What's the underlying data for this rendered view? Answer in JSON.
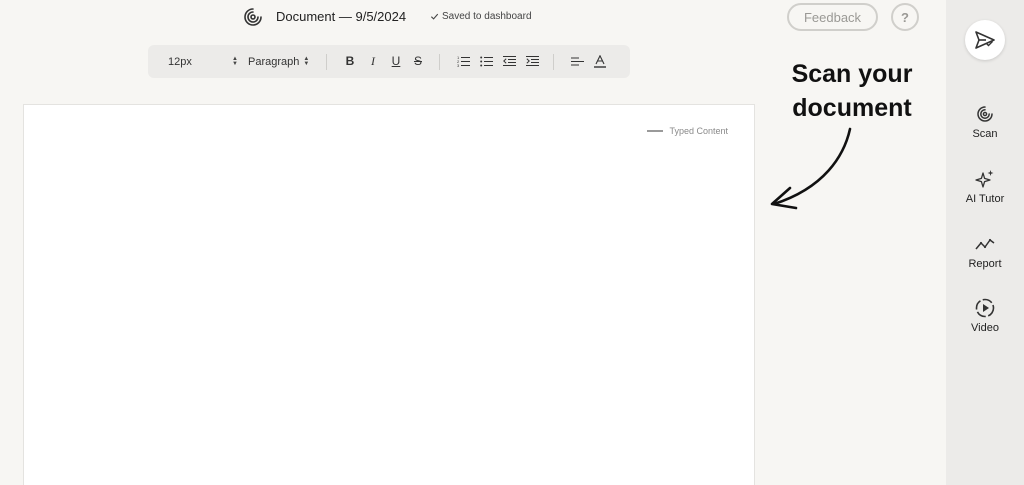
{
  "header": {
    "doc_title": "Document — 9/5/2024",
    "saved_status": "Saved to dashboard",
    "feedback_label": "Feedback",
    "help_label": "?"
  },
  "toolbar": {
    "font_size": "12px",
    "block_type": "Paragraph",
    "bold": "B",
    "italic": "I",
    "underline": "U",
    "strike": "S"
  },
  "editor": {
    "legend_label": "Typed Content"
  },
  "annotation": {
    "line1": "Scan your",
    "line2": "document"
  },
  "sidebar": {
    "items": [
      {
        "label": "Scan",
        "icon": "scan-icon"
      },
      {
        "label": "AI Tutor",
        "icon": "sparkles-icon"
      },
      {
        "label": "Report",
        "icon": "chart-line-icon"
      },
      {
        "label": "Video",
        "icon": "play-circle-icon"
      }
    ]
  },
  "colors": {
    "background": "#f7f6f3",
    "sidebar": "#ecebe9",
    "toolbar": "#ecebe9",
    "page": "#ffffff"
  }
}
